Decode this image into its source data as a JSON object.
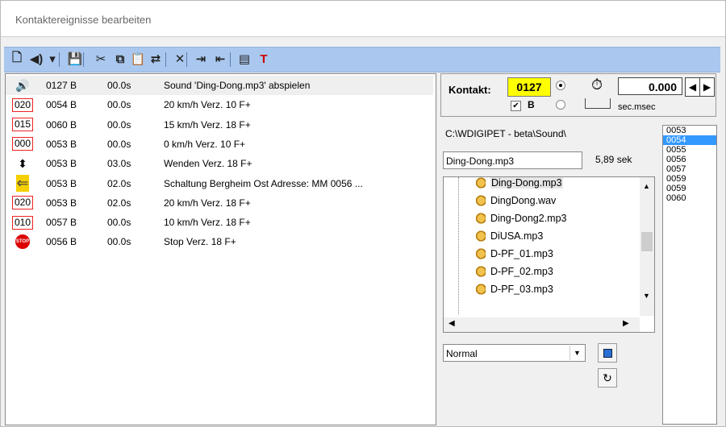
{
  "window": {
    "title": "Kontaktereignisse bearbeiten"
  },
  "toolbar": {
    "buttons": [
      {
        "name": "new-icon",
        "glyph": "🗋"
      },
      {
        "name": "sound-icon",
        "glyph": "◀)"
      },
      {
        "name": "dropdown-arrow-icon",
        "glyph": "▾"
      },
      {
        "name": "save-icon",
        "glyph": "💾"
      },
      {
        "name": "cut-icon",
        "glyph": "✂"
      },
      {
        "name": "copy-icon",
        "glyph": "⧉"
      },
      {
        "name": "paste-icon",
        "glyph": "📋"
      },
      {
        "name": "replace-icon",
        "glyph": "⇄"
      },
      {
        "name": "delete-icon",
        "glyph": "✕"
      },
      {
        "name": "indent-icon",
        "glyph": "⇥"
      },
      {
        "name": "outdent-icon",
        "glyph": "⇤"
      },
      {
        "name": "table-icon",
        "glyph": "▤"
      },
      {
        "name": "text-tool-icon",
        "glyph": "T"
      }
    ]
  },
  "events": [
    {
      "icon": "speaker-icon",
      "badge": "",
      "contact": "0127 B",
      "time": "00.0s",
      "desc": "Sound 'Ding-Dong.mp3' abspielen",
      "selected": true
    },
    {
      "icon": "speed-icon",
      "badge": "020",
      "contact": "0054 B",
      "time": "00.0s",
      "desc": "20 km/h Verz. 10 F+",
      "selected": false
    },
    {
      "icon": "speed-icon",
      "badge": "015",
      "contact": "0060 B",
      "time": "00.0s",
      "desc": "15 km/h Verz. 18 F+",
      "selected": false
    },
    {
      "icon": "speed-icon",
      "badge": "000",
      "contact": "0053 B",
      "time": "00.0s",
      "desc": "0 km/h Verz. 10 F+",
      "selected": false
    },
    {
      "icon": "reverse-icon",
      "badge": "",
      "contact": "0053 B",
      "time": "03.0s",
      "desc": "Wenden Verz. 18 F+",
      "selected": false
    },
    {
      "icon": "switch-icon",
      "badge": "",
      "contact": "0053 B",
      "time": "02.0s",
      "desc": "Schaltung Bergheim Ost Adresse: MM 0056 ...",
      "selected": false
    },
    {
      "icon": "speed-icon",
      "badge": "020",
      "contact": "0053 B",
      "time": "02.0s",
      "desc": "20 km/h Verz. 18 F+",
      "selected": false
    },
    {
      "icon": "speed-icon",
      "badge": "010",
      "contact": "0057 B",
      "time": "00.0s",
      "desc": "10 km/h Verz. 18 F+",
      "selected": false
    },
    {
      "icon": "stop-icon",
      "badge": "",
      "contact": "0056 B",
      "time": "00.0s",
      "desc": "Stop Verz. 18 F+",
      "selected": false
    }
  ],
  "panel": {
    "kontakt_label": "Kontakt:",
    "kontakt_value": "0127",
    "b_label": "B",
    "time_value": "0.000",
    "time_unit": "sec.msec",
    "path": "C:\\WDIGIPET - beta\\Sound\\",
    "file_value": "Ding-Dong.mp3",
    "duration": "5,89 sek",
    "files": [
      {
        "label": "Ding-Dong.mp3",
        "selected": true
      },
      {
        "label": "DingDong.wav",
        "selected": false
      },
      {
        "label": "Ding-Dong2.mp3",
        "selected": false
      },
      {
        "label": "DiUSA.mp3",
        "selected": false
      },
      {
        "label": "D-PF_01.mp3",
        "selected": false
      },
      {
        "label": "D-PF_02.mp3",
        "selected": false
      },
      {
        "label": "D-PF_03.mp3",
        "selected": false
      }
    ],
    "mode_value": "Normal"
  },
  "contacts": [
    {
      "label": "0053",
      "selected": false
    },
    {
      "label": "0054",
      "selected": true
    },
    {
      "label": "0055",
      "selected": false
    },
    {
      "label": "0056",
      "selected": false
    },
    {
      "label": "0057",
      "selected": false
    },
    {
      "label": "0059",
      "selected": false
    },
    {
      "label": "0059",
      "selected": false
    },
    {
      "label": "0060",
      "selected": false
    }
  ],
  "colors": {
    "toolbar": "#aac8ef",
    "highlight": "#ffff00",
    "selection": "#3399ff",
    "badge_border": "#e22222"
  }
}
